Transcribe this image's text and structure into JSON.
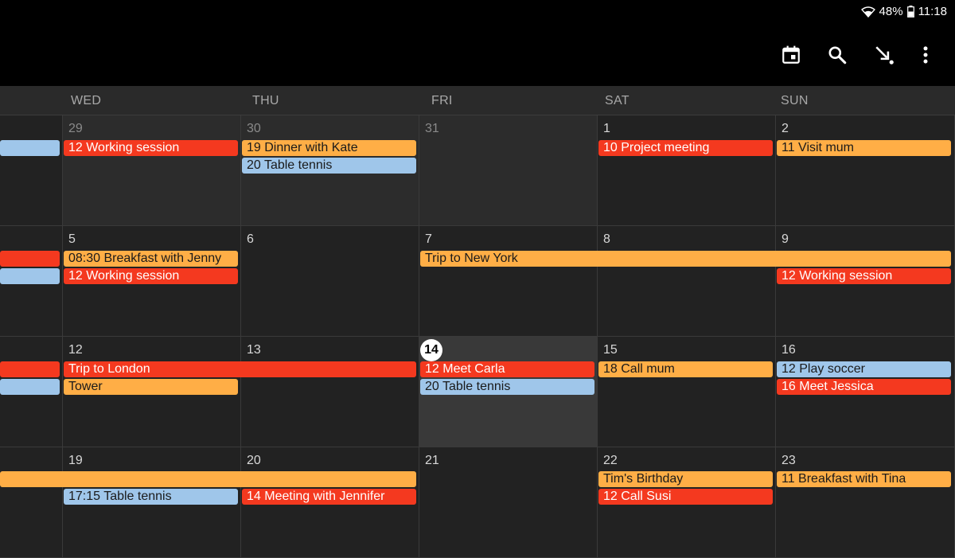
{
  "status": {
    "battery": "48%",
    "time": "11:18"
  },
  "toolbar": {
    "icons": [
      "calendar-today-icon",
      "search-icon",
      "go-to-now-icon",
      "more-vert-icon"
    ]
  },
  "colors": {
    "red": "#f4391f",
    "orange": "#ffae46",
    "blue": "#9fc6ea",
    "background": "#202020",
    "today": "#393939"
  },
  "days": [
    "WED",
    "THU",
    "FRI",
    "SAT",
    "SUN"
  ],
  "weeks": [
    {
      "dates": [
        "29",
        "30",
        "31",
        "1",
        "2"
      ]
    },
    {
      "dates": [
        "5",
        "6",
        "7",
        "8",
        "9"
      ]
    },
    {
      "dates": [
        "12",
        "13",
        "14",
        "15",
        "16"
      ]
    },
    {
      "dates": [
        "19",
        "20",
        "21",
        "22",
        "23"
      ]
    }
  ],
  "events": {
    "w0": {
      "partial_blue": "",
      "wed_1": "12 Working session",
      "thu_1": "19 Dinner with Kate",
      "thu_2": "20 Table tennis",
      "sat_1": "10 Project meeting",
      "sun_1": "11 Visit mum"
    },
    "w1": {
      "partial_red": "",
      "partial_blue": "",
      "wed_1": "08:30 Breakfast with Jenny",
      "wed_2": "12 Working session",
      "fri_sun_1": "Trip to New York",
      "sun_2": "12 Working session"
    },
    "w2": {
      "partial_red": "",
      "partial_blue": "",
      "wed_thu_1": "Trip to London",
      "wed_2": "Tower",
      "fri_1": "12 Meet Carla",
      "fri_2": "20 Table tennis",
      "sat_1": "18 Call mum",
      "sun_1": "12 Play soccer",
      "sun_2": "16 Meet Jessica"
    },
    "w3": {
      "partial_orange": "",
      "wed_2": "17:15 Table tennis",
      "thu_2": "14 Meeting with Jennifer",
      "sat_1": "Tim's Birthday",
      "sat_2": "12 Call Susi",
      "sun_1": "11 Breakfast with Tina"
    }
  }
}
